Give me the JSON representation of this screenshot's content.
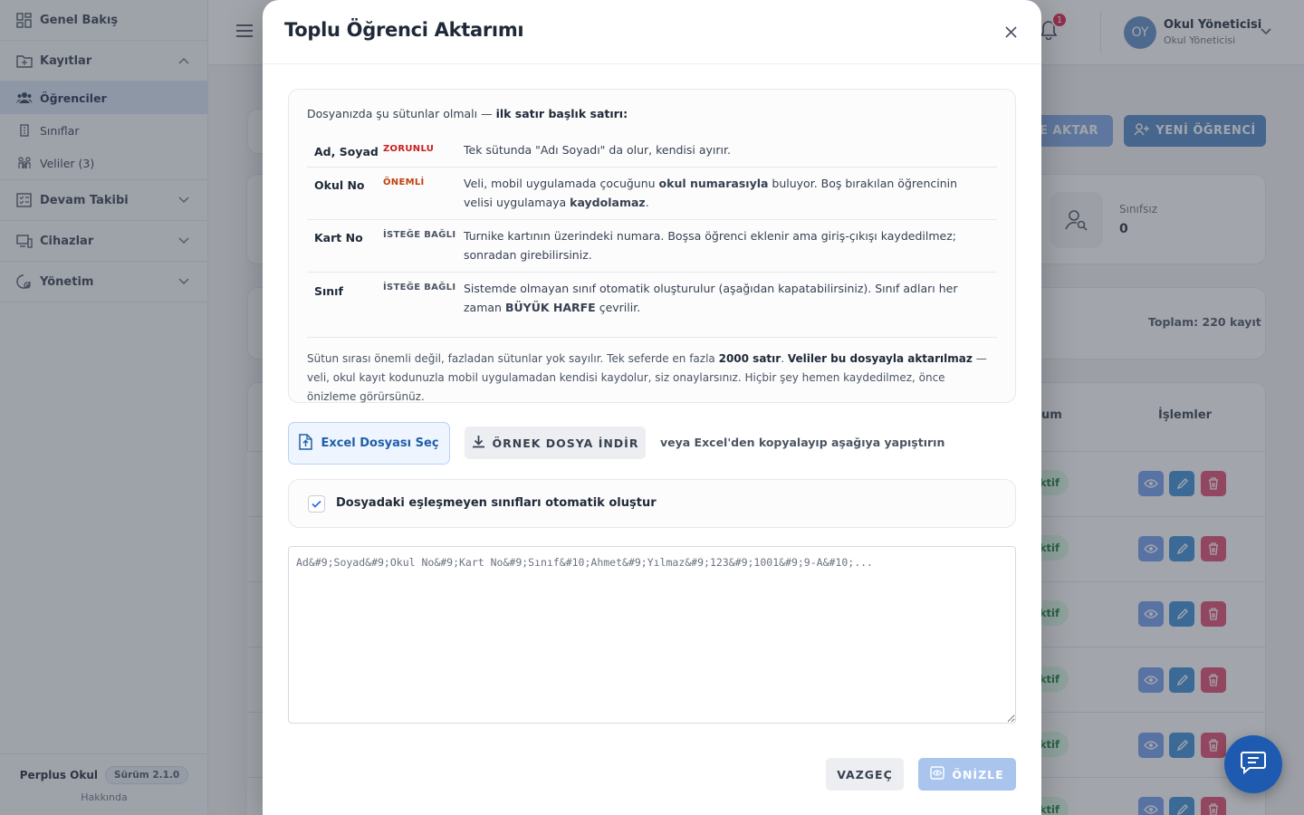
{
  "sidebar": {
    "overview": "Genel Bakış",
    "records": "Kayıtlar",
    "students": "Öğrenciler",
    "classes": "Sınıflar",
    "parents": "Veliler (3)",
    "attendance": "Devam Takibi",
    "devices": "Cihazlar",
    "admin": "Yönetim",
    "brand": "Perplus Okul",
    "version": "Sürüm 2.1.0",
    "about": "Hakkında"
  },
  "topbar": {
    "notification_count": "1",
    "avatar_initials": "OY",
    "user_name": "Okul Yöneticisi",
    "user_role": "Okul Yöneticisi"
  },
  "background": {
    "import_btn": "CE AKTAR",
    "new_student_btn": "YENİ ÖĞRENCİ",
    "stat_label": "Sınıfsız",
    "stat_value": "0",
    "total": "Toplam: 220 kayıt",
    "th_status": "um",
    "th_actions": "İşlemler",
    "status_pill": "ktif"
  },
  "modal": {
    "title": "Toplu Öğrenci Aktarımı",
    "intro_prefix": "Dosyanızda şu sütunlar olmalı — ",
    "intro_bold": "ilk satır başlık satırı:",
    "columns": [
      {
        "name": "Ad, Soyad",
        "tag": "ZORUNLU"
      },
      {
        "name": "Okul No",
        "tag": "ÖNEMLİ"
      },
      {
        "name": "Kart No",
        "tag": "İSTEĞE BAĞLI"
      },
      {
        "name": "Sınıf",
        "tag": "İSTEĞE BAĞLI"
      }
    ],
    "desc_adsoyad": "Tek sütunda \"Adı Soyadı\" da olur, kendisi ayırır.",
    "desc_okulno_1": "Veli, mobil uygulamada çocuğunu ",
    "desc_okulno_b1": "okul numarasıyla",
    "desc_okulno_2": " buluyor. Boş bırakılan öğrencinin velisi uygulamaya ",
    "desc_okulno_b2": "kaydolamaz",
    "desc_okulno_3": ".",
    "desc_kartno": "Turnike kartının üzerindeki numara. Boşsa öğrenci eklenir ama giriş-çıkışı kaydedilmez; sonradan girebilirsiniz.",
    "desc_sinif_1": "Sistemde olmayan sınıf otomatik oluşturulur (aşağıdan kapatabilirsiniz). Sınıf adları her zaman ",
    "desc_sinif_b": "BÜYÜK HARFE",
    "desc_sinif_2": " çevrilir.",
    "note_1": "Sütun sırası önemli değil, fazladan sütunlar yok sayılır. Tek seferde en fazla ",
    "note_b1": "2000 satır",
    "note_2": ". ",
    "note_b2": "Veliler bu dosyayla aktarılmaz",
    "note_3": " — veli, okul kayıt kodunuzla mobil uygulamadan kendisi kaydolur, siz onaylarsınız. Hiçbir şey hemen kaydedilmez, önce önizleme görürsünüz.",
    "excel_btn": "Excel Dosyası Seç",
    "sample_btn": "ÖRNEK DOSYA İNDİR",
    "paste_hint": "veya Excel'den kopyalayıp aşağıya yapıştırın",
    "auto_create_label": "Dosyadaki eşleşmeyen sınıfları otomatik oluştur",
    "auto_create_checked": true,
    "paste_placeholder": "Ad&#9;Soyad&#9;Okul No&#9;Kart No&#9;Sınıf&#10;Ahmet&#9;Yılmaz&#9;123&#9;1001&#9;9-A&#10;...",
    "cancel_btn": "VAZGEÇ",
    "preview_btn": "ÖNİZLE"
  }
}
